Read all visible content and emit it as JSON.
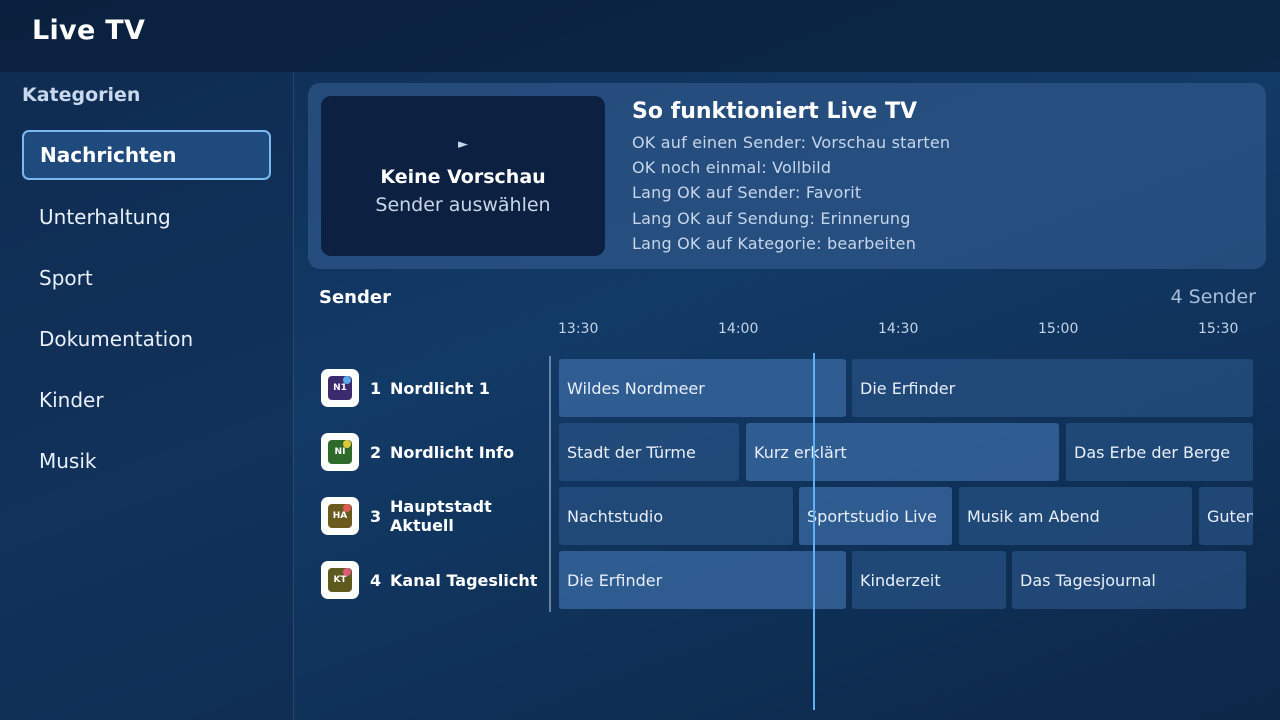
{
  "app": {
    "title": "Live TV"
  },
  "sidebar": {
    "heading": "Kategorien",
    "items": [
      {
        "label": "Nachrichten",
        "active": true
      },
      {
        "label": "Unterhaltung"
      },
      {
        "label": "Sport"
      },
      {
        "label": "Dokumentation"
      },
      {
        "label": "Kinder"
      },
      {
        "label": "Musik"
      }
    ]
  },
  "preview": {
    "play_glyph": "►",
    "title": "Keine Vorschau",
    "subtitle": "Sender auswählen"
  },
  "help": {
    "title": "So funktioniert Live TV",
    "lines": [
      "OK auf einen Sender: Vorschau starten",
      "OK noch einmal: Vollbild",
      "Lang OK auf Sender: Favorit",
      "Lang OK auf Sendung: Erinnerung",
      "Lang OK auf Kategorie: bearbeiten"
    ]
  },
  "guide": {
    "section_label": "Sender",
    "channel_count": "4 Sender",
    "times": [
      "13:30",
      "14:00",
      "14:30",
      "15:00",
      "15:30"
    ],
    "channels": [
      {
        "number": "1",
        "name": "Nordlicht 1",
        "logo": {
          "abbr": "N1",
          "color": "#3b2a6e",
          "dot": "#5aa9e8"
        },
        "programs": [
          {
            "title": "Wildes Nordmeer",
            "current": true
          },
          {
            "title": "Die Erfinder"
          }
        ]
      },
      {
        "number": "2",
        "name": "Nordlicht Info",
        "logo": {
          "abbr": "NI",
          "color": "#2f6a2a",
          "dot": "#e0c63a"
        },
        "programs": [
          {
            "title": "Stadt der Türme"
          },
          {
            "title": "Kurz erklärt",
            "current": true
          },
          {
            "title": "Das Erbe der Berge"
          }
        ]
      },
      {
        "number": "3",
        "name": "Hauptstadt Aktuell",
        "logo": {
          "abbr": "HA",
          "color": "#6a5a1e",
          "dot": "#e05a5a"
        },
        "programs": [
          {
            "title": "Nachtstudio"
          },
          {
            "title": "Sportstudio Live",
            "current": true
          },
          {
            "title": "Musik am Abend"
          },
          {
            "title": "Guten"
          }
        ]
      },
      {
        "number": "4",
        "name": "Kanal Tageslicht",
        "logo": {
          "abbr": "KT",
          "color": "#5e5a1e",
          "dot": "#e05a7a"
        },
        "programs": [
          {
            "title": "Die Erfinder",
            "current": true
          },
          {
            "title": "Kinderzeit"
          },
          {
            "title": "Das Tagesjournal"
          }
        ]
      }
    ]
  }
}
